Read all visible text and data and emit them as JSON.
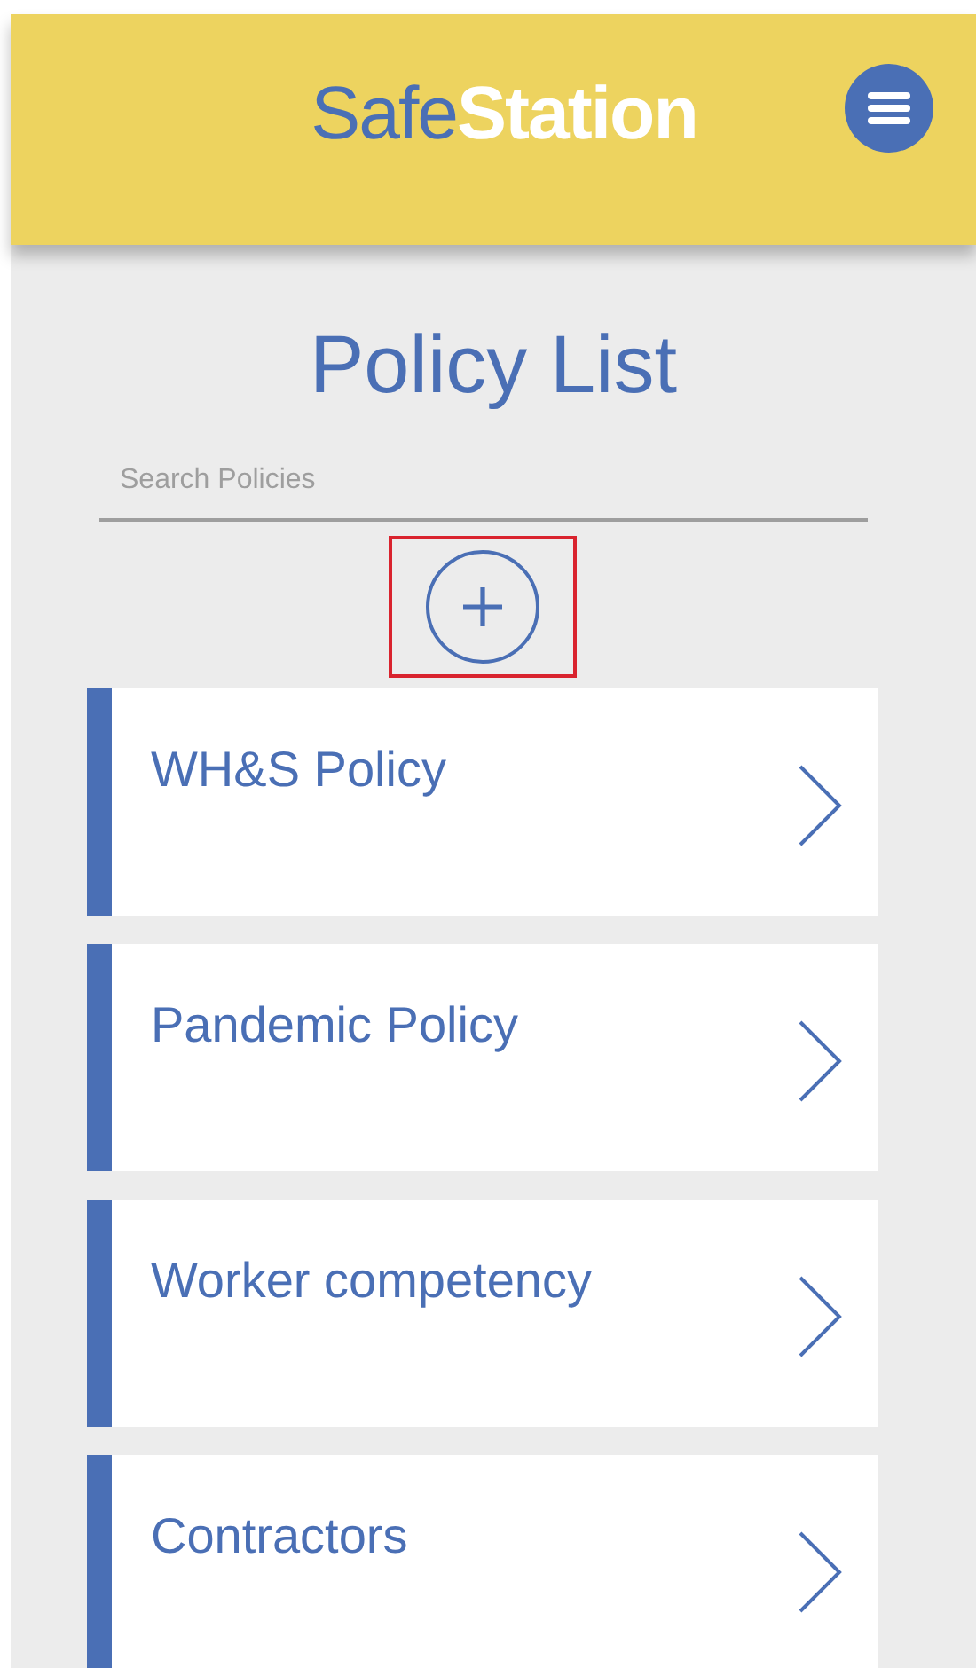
{
  "header": {
    "logo": "Safe**Station**"
  },
  "page_title": "Policy List",
  "search": {
    "placeholder": "Search Policies"
  },
  "add_button": {
    "highlighted": true
  },
  "policies": [
    {
      "name": "WH&S Policy"
    },
    {
      "name": "Pandemic Policy"
    },
    {
      "name": "Worker competency"
    },
    {
      "name": "Contractors"
    }
  ]
}
